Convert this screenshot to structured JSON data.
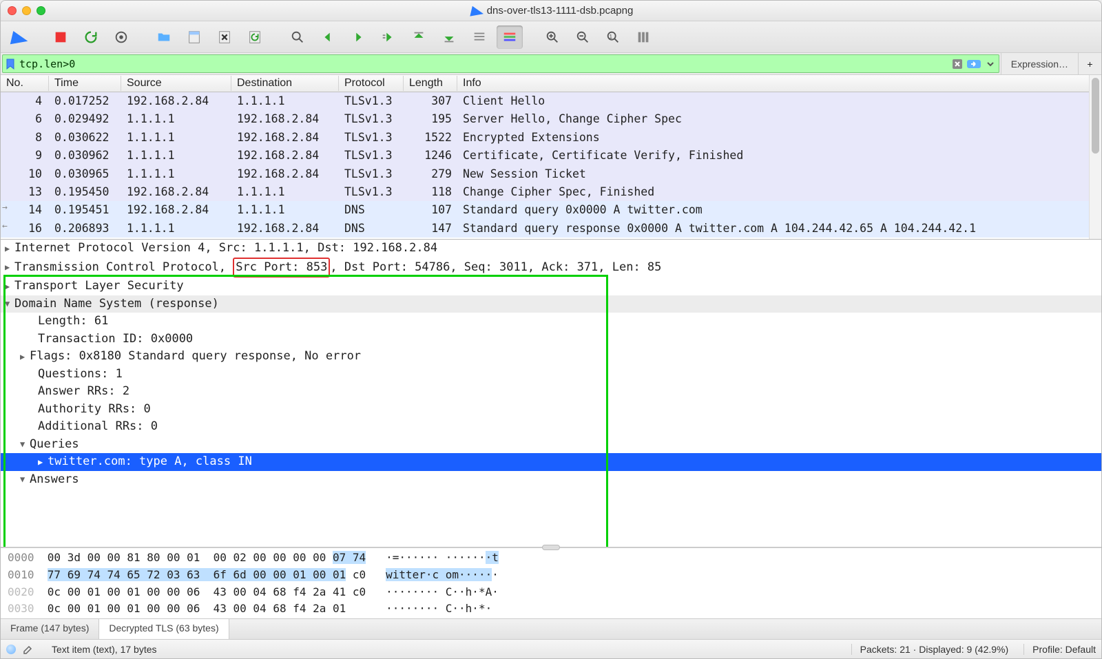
{
  "title": "dns-over-tls13-1111-dsb.pcapng",
  "filter": {
    "value": "tcp.len>0",
    "expression_label": "Expression…"
  },
  "columns": [
    "No.",
    "Time",
    "Source",
    "Destination",
    "Protocol",
    "Length",
    "Info"
  ],
  "packets": [
    {
      "no": "4",
      "time": "0.017252",
      "src": "192.168.2.84",
      "dst": "1.1.1.1",
      "prot": "TLSv1.3",
      "len": "307",
      "info": "Client Hello",
      "cls": "tls"
    },
    {
      "no": "6",
      "time": "0.029492",
      "src": "1.1.1.1",
      "dst": "192.168.2.84",
      "prot": "TLSv1.3",
      "len": "195",
      "info": "Server Hello, Change Cipher Spec",
      "cls": "tls"
    },
    {
      "no": "8",
      "time": "0.030622",
      "src": "1.1.1.1",
      "dst": "192.168.2.84",
      "prot": "TLSv1.3",
      "len": "1522",
      "info": "Encrypted Extensions",
      "cls": "tls"
    },
    {
      "no": "9",
      "time": "0.030962",
      "src": "1.1.1.1",
      "dst": "192.168.2.84",
      "prot": "TLSv1.3",
      "len": "1246",
      "info": "Certificate, Certificate Verify, Finished",
      "cls": "tls"
    },
    {
      "no": "10",
      "time": "0.030965",
      "src": "1.1.1.1",
      "dst": "192.168.2.84",
      "prot": "TLSv1.3",
      "len": "279",
      "info": "New Session Ticket",
      "cls": "tls"
    },
    {
      "no": "13",
      "time": "0.195450",
      "src": "192.168.2.84",
      "dst": "1.1.1.1",
      "prot": "TLSv1.3",
      "len": "118",
      "info": "Change Cipher Spec, Finished",
      "cls": "tls"
    },
    {
      "no": "14",
      "time": "0.195451",
      "src": "192.168.2.84",
      "dst": "1.1.1.1",
      "prot": "DNS",
      "len": "107",
      "info": "Standard query 0x0000 A twitter.com",
      "cls": "dns",
      "arrow": "out"
    },
    {
      "no": "16",
      "time": "0.206893",
      "src": "1.1.1.1",
      "dst": "192.168.2.84",
      "prot": "DNS",
      "len": "147",
      "info": "Standard query response 0x0000 A twitter.com A 104.244.42.65 A 104.244.42.1",
      "cls": "dns",
      "arrow": "in"
    }
  ],
  "details": {
    "ipv4": "Internet Protocol Version 4, Src: 1.1.1.1, Dst: 192.168.2.84",
    "tcp_pre": "Transmission Control Protocol, ",
    "tcp_src_port": "Src Port: 853",
    "tcp_rest": ", Dst Port: 54786, Seq: 3011, Ack: 371, Len: 85",
    "tls": "Transport Layer Security",
    "dns": "Domain Name System (response)",
    "dns_children": {
      "length": "Length: 61",
      "tid": "Transaction ID: 0x0000",
      "flags": "Flags: 0x8180 Standard query response, No error",
      "questions": "Questions: 1",
      "answers_rr": "Answer RRs: 2",
      "authority": "Authority RRs: 0",
      "additional": "Additional RRs: 0",
      "queries": "Queries",
      "query_item": "twitter.com: type A, class IN",
      "answers": "Answers"
    }
  },
  "hex": {
    "r0": {
      "off": "0000",
      "bytes": "00 3d 00 00 81 80 00 01  00 02 00 00 00 00 ",
      "hl": "07 74",
      "tail": "   ",
      "ascii": "·=······ ······",
      "ascii_hl": "·t"
    },
    "r1": {
      "off": "0010",
      "hl": "77 69 74 74 65 72 03 63  6f 6d 00 00 01 00 01",
      "tail": " c0   ",
      "ascii_hl": "witter·c om·····",
      "ascii_tail": "·"
    },
    "r2": {
      "off": "0020",
      "bytes": "0c 00 01 00 01 00 00 06  43 00 04 68 f4 2a 41 c0   ",
      "ascii": "········ C··h·*A·"
    },
    "r3": {
      "off": "0030",
      "bytes": "0c 00 01 00 01 00 00 06  43 00 04 68 f4 2a 01      ",
      "ascii": "········ C··h·*· "
    }
  },
  "tabs": {
    "frame": "Frame (147 bytes)",
    "tls": "Decrypted TLS (63 bytes)"
  },
  "status": {
    "item": "Text item (text), 17 bytes",
    "packets": "Packets: 21 · Displayed: 9 (42.9%)",
    "profile": "Profile: Default"
  }
}
